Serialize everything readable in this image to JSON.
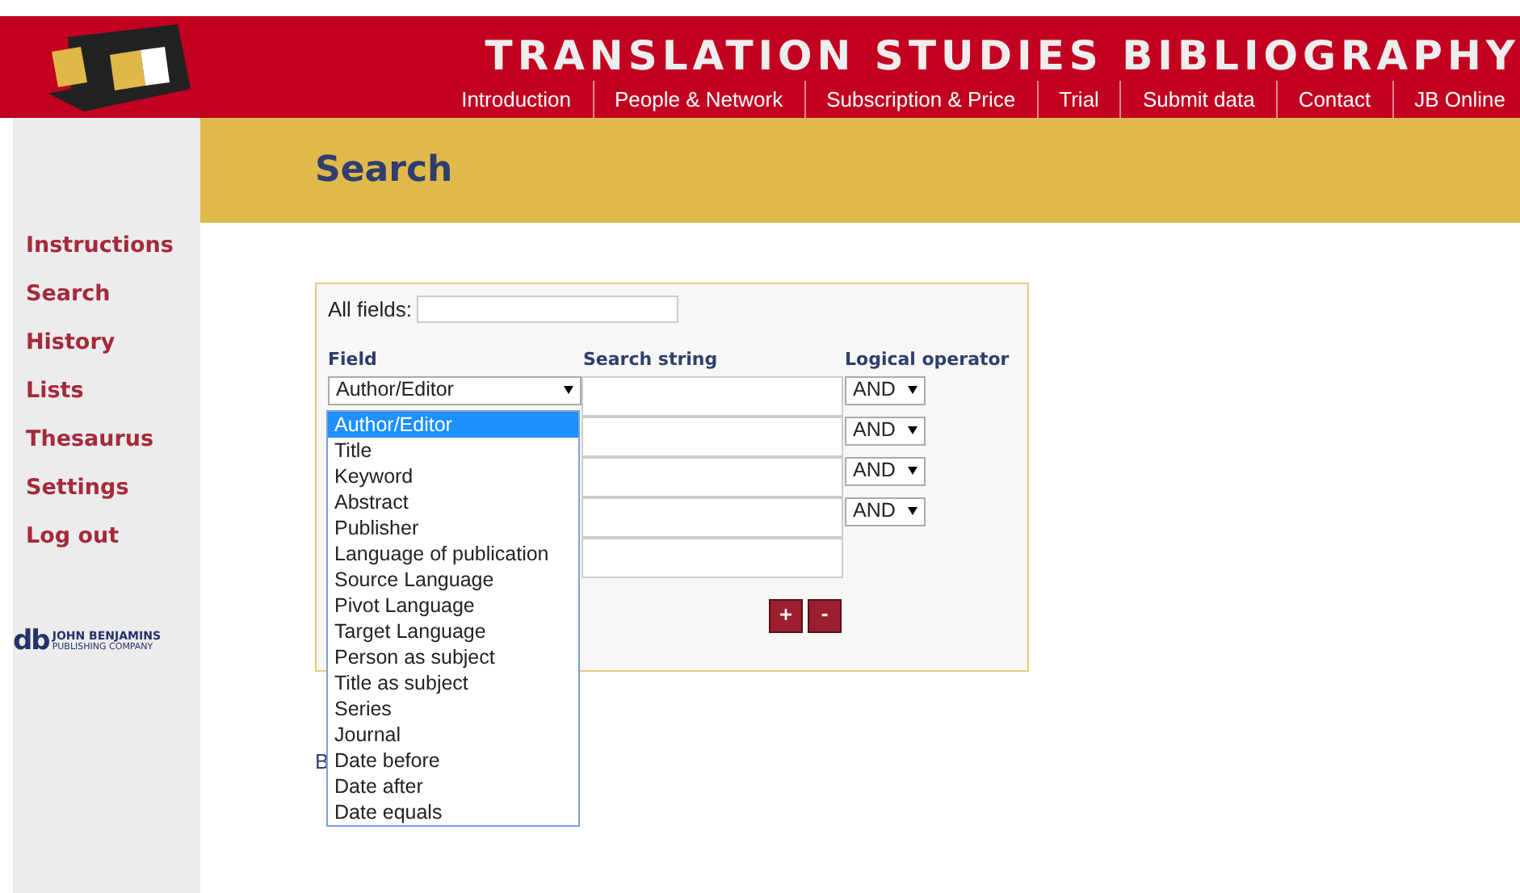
{
  "header": {
    "title": "TRANSLATION STUDIES BIBLIOGRAPHY",
    "nav": [
      "Introduction",
      "People & Network",
      "Subscription & Price",
      "Trial",
      "Submit data",
      "Contact",
      "JB Online"
    ]
  },
  "page_title": "Search",
  "sidebar": {
    "items": [
      "Instructions",
      "Search",
      "History",
      "Lists",
      "Thesaurus",
      "Settings",
      "Log out"
    ],
    "publisher_mark": "db",
    "publisher_name": "JOHN BENJAMINS",
    "publisher_sub": "PUBLISHING COMPANY"
  },
  "form": {
    "all_fields_label": "All fields:",
    "columns": [
      "Field",
      "Search string",
      "Logical operator"
    ],
    "rows": [
      {
        "field": "Author/Editor",
        "operator": "AND"
      },
      {
        "operator": "AND"
      },
      {
        "operator": "AND"
      },
      {
        "operator": "AND"
      },
      {}
    ],
    "buttons": [
      "+",
      "-"
    ],
    "covered_text": "B",
    "dropdown": {
      "options": [
        {
          "label": "Author/Editor",
          "selected": true
        },
        {
          "label": "Title",
          "selected": false
        },
        {
          "label": "Keyword",
          "selected": false
        },
        {
          "label": "Abstract",
          "selected": false
        },
        {
          "label": "Publisher",
          "selected": false
        },
        {
          "label": "Language of publication",
          "selected": false
        },
        {
          "label": "Source Language",
          "selected": false
        },
        {
          "label": "Pivot Language",
          "selected": false
        },
        {
          "label": "Target Language",
          "selected": false
        },
        {
          "label": "Person as subject",
          "selected": false
        },
        {
          "label": "Title as subject",
          "selected": false
        },
        {
          "label": "Series",
          "selected": false
        },
        {
          "label": "Journal",
          "selected": false
        },
        {
          "label": "Date before",
          "selected": false
        },
        {
          "label": "Date after",
          "selected": false
        },
        {
          "label": "Date equals",
          "selected": false
        }
      ]
    }
  }
}
